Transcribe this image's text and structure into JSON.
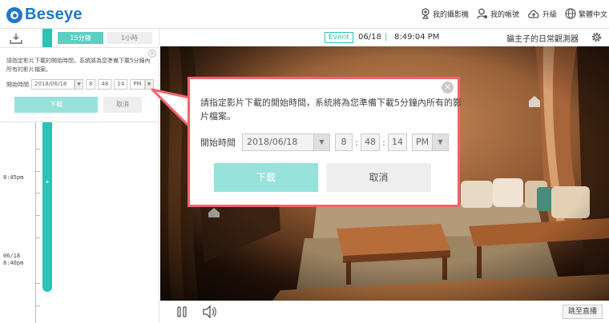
{
  "app": {
    "brand": "Beseye"
  },
  "nav": {
    "my_cameras": "我的攝影機",
    "my_account": "我的帳號",
    "upgrade": "升級",
    "language": "繁體中文"
  },
  "sidebar": {
    "range_15min": "15分鐘",
    "range_1hour": "1小時",
    "panel": {
      "message": "請指定影片下載的開始時間，系統將為您準備下載5分鐘內所有的影片檔案。",
      "time_label": "開始時間",
      "date": "2018/06/18",
      "hour": "8",
      "minute": "48",
      "second": "14",
      "ampm": "PM",
      "confirm": "下載",
      "cancel": "取消"
    },
    "timeline": {
      "label_1": "8:45pm",
      "label_2_date": "06/18",
      "label_2_time": "8:40pm"
    }
  },
  "video_header": {
    "badge": "Event",
    "date": "06/18",
    "separator": "|",
    "time": "8:49:04 PM",
    "camera_name": "貓主子的日常觀測器"
  },
  "dialog": {
    "message": "請指定影片下載的開始時間，系統將為您準備下載5分鐘內所有的影片檔案。",
    "time_label": "開始時間",
    "date": "2018/06/18",
    "hour": "8",
    "minute": "48",
    "second": "14",
    "ampm": "PM",
    "confirm": "下載",
    "cancel": "取消",
    "close": "×"
  },
  "controls": {
    "go_live": "跳至直播"
  },
  "colors": {
    "brand": "#1f78c8",
    "accent": "#2cc2b4",
    "dialog_border": "#f2636b",
    "confirm_button": "#97e2da"
  }
}
